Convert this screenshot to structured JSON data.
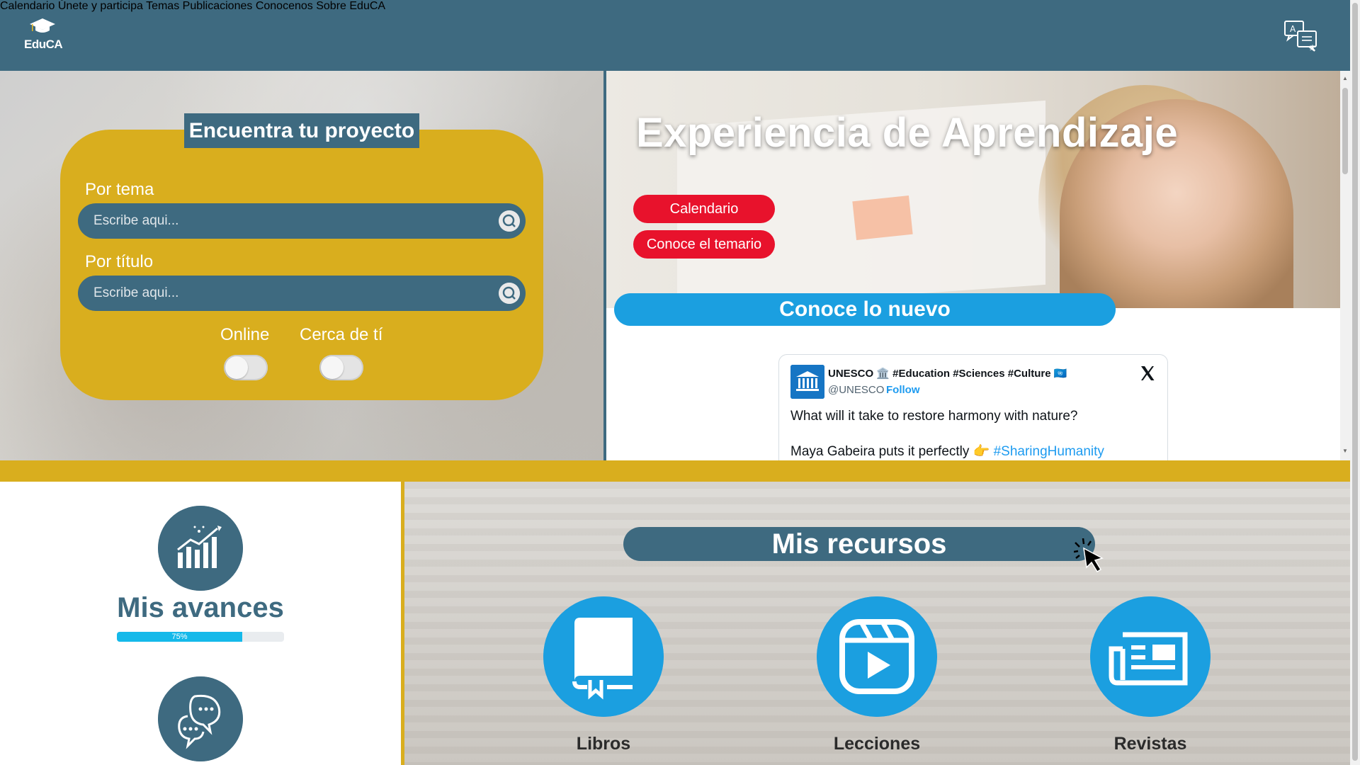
{
  "brand": {
    "logo_text": "EduCA"
  },
  "nav": {
    "items": [
      "Calendario",
      "Únete y participa",
      "Temas",
      "Publicaciones",
      "Conocenos",
      "Sobre EduCA"
    ]
  },
  "search": {
    "title": "Encuentra tu proyecto",
    "by_topic_label": "Por tema",
    "by_topic_placeholder": "Escribe aqui...",
    "by_title_label": "Por título",
    "by_title_placeholder": "Escribe aqui...",
    "toggle_online": "Online",
    "toggle_near": "Cerca de tí"
  },
  "hero": {
    "title": "Experiencia de Aprendizaje",
    "btn_calendar": "Calendario",
    "btn_syllabus": "Conoce el temario",
    "news_bar": "Conoce lo nuevo"
  },
  "tweet": {
    "name": "UNESCO 🏛️ #Education #Sciences #Culture 🇺🇳",
    "handle": "@UNESCO ·",
    "follow": "Follow",
    "line1": "What will it take to restore harmony with nature?",
    "line2_text": "Maya Gabeira puts it perfectly 👉 ",
    "line2_hashtag": "#SharingHumanity"
  },
  "progress": {
    "title": "Mis avances",
    "value": 0.75,
    "label": "75%"
  },
  "resources": {
    "title": "Mis recursos",
    "items": [
      "Libros",
      "Lecciones",
      "Revistas"
    ]
  },
  "colors": {
    "header": "#3e6a80",
    "accent_yellow": "#d9ae1e",
    "accent_blue": "#1b9fe0",
    "accent_red": "#e8122c",
    "progress_fill": "#15b9ea"
  }
}
